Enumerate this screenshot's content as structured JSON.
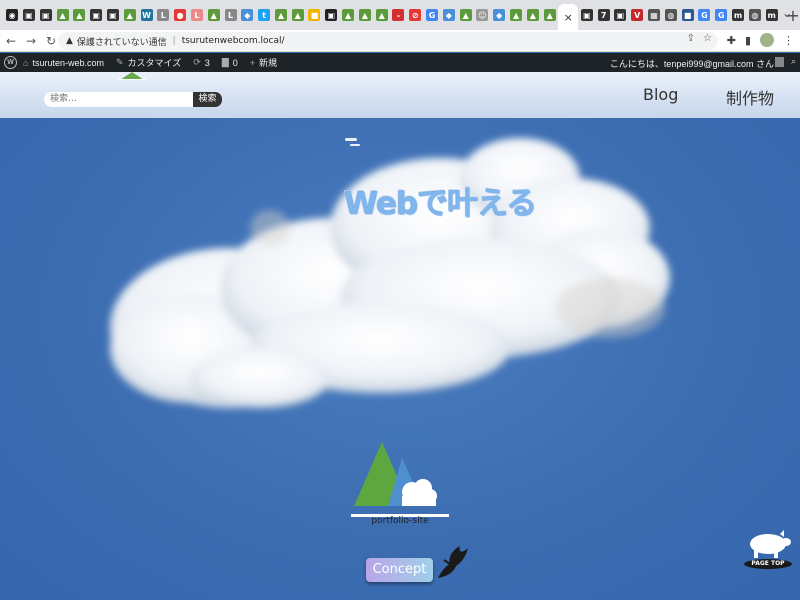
{
  "browser": {
    "tabs": [
      {
        "icon": "github-icon",
        "color": "#222",
        "glyph": "◉"
      },
      {
        "icon": "app-icon",
        "color": "#333",
        "glyph": "▣"
      },
      {
        "icon": "app-icon",
        "color": "#333",
        "glyph": "▣"
      },
      {
        "icon": "site-icon",
        "color": "#5c9b3c",
        "glyph": "▲"
      },
      {
        "icon": "site-icon",
        "color": "#5c9b3c",
        "glyph": "▲"
      },
      {
        "icon": "app-icon",
        "color": "#333",
        "glyph": "▣"
      },
      {
        "icon": "app-icon",
        "color": "#333",
        "glyph": "▣"
      },
      {
        "icon": "site-icon",
        "color": "#5c9b3c",
        "glyph": "▲"
      },
      {
        "icon": "wordpress-icon",
        "color": "#21759b",
        "glyph": "W"
      },
      {
        "icon": "life-icon",
        "color": "#888",
        "glyph": "L"
      },
      {
        "icon": "record-icon",
        "color": "#e53935",
        "glyph": "●"
      },
      {
        "icon": "life-icon",
        "color": "#e88",
        "glyph": "L"
      },
      {
        "icon": "site-icon",
        "color": "#5c9b3c",
        "glyph": "▲"
      },
      {
        "icon": "life-icon",
        "color": "#888",
        "glyph": "L"
      },
      {
        "icon": "shield-icon",
        "color": "#4a90d9",
        "glyph": "◆"
      },
      {
        "icon": "twitter-icon",
        "color": "#1da1f2",
        "glyph": "t"
      },
      {
        "icon": "site-icon",
        "color": "#5c9b3c",
        "glyph": "▲"
      },
      {
        "icon": "site-icon",
        "color": "#5c9b3c",
        "glyph": "▲"
      },
      {
        "icon": "folder-icon",
        "color": "#f4b400",
        "glyph": "■"
      },
      {
        "icon": "app-icon",
        "color": "#222",
        "glyph": "▣"
      },
      {
        "icon": "site-icon",
        "color": "#5c9b3c",
        "glyph": "▲"
      },
      {
        "icon": "site-icon",
        "color": "#5c9b3c",
        "glyph": "▲"
      },
      {
        "icon": "site-icon",
        "color": "#5c9b3c",
        "glyph": "▲"
      },
      {
        "icon": "minus-icon",
        "color": "#d32f2f",
        "glyph": "–"
      },
      {
        "icon": "blocked-icon",
        "color": "#e53935",
        "glyph": "⊘"
      },
      {
        "icon": "google-icon",
        "color": "#4285f4",
        "glyph": "G"
      },
      {
        "icon": "shield-icon",
        "color": "#4a90d9",
        "glyph": "◆"
      },
      {
        "icon": "site-icon",
        "color": "#5c9b3c",
        "glyph": "▲"
      },
      {
        "icon": "person-icon",
        "color": "#999",
        "glyph": "☺"
      },
      {
        "icon": "shield-icon",
        "color": "#4a90d9",
        "glyph": "◆"
      },
      {
        "icon": "site-icon",
        "color": "#5c9b3c",
        "glyph": "▲"
      },
      {
        "icon": "site-icon",
        "color": "#5c9b3c",
        "glyph": "▲"
      },
      {
        "icon": "site-icon",
        "color": "#5c9b3c",
        "glyph": "▲"
      }
    ],
    "active_tab_close": "×",
    "tabs_after": [
      {
        "icon": "app-icon",
        "color": "#333",
        "glyph": "▣"
      },
      {
        "icon": "number-icon",
        "color": "#333",
        "glyph": "7"
      },
      {
        "icon": "app-icon",
        "color": "#333",
        "glyph": "▣"
      },
      {
        "icon": "v-icon",
        "color": "#c62828",
        "glyph": "V"
      },
      {
        "icon": "image-icon",
        "color": "#555",
        "glyph": "▦"
      },
      {
        "icon": "globe-icon",
        "color": "#555",
        "glyph": "◍"
      },
      {
        "icon": "square-icon",
        "color": "#2b5797",
        "glyph": "■"
      },
      {
        "icon": "google-icon",
        "color": "#4285f4",
        "glyph": "G"
      },
      {
        "icon": "google-icon",
        "color": "#4285f4",
        "glyph": "G"
      },
      {
        "icon": "m-icon",
        "color": "#333",
        "glyph": "m"
      },
      {
        "icon": "globe-icon",
        "color": "#555",
        "glyph": "◍"
      },
      {
        "icon": "m-icon",
        "color": "#333",
        "glyph": "m"
      }
    ],
    "new_tab": "+",
    "address": {
      "warning": "保護されていない通信",
      "url": "tsurutenwebcom.local/"
    }
  },
  "wp_admin_bar": {
    "site_name": "tsuruten-web.com",
    "customize": "カスタマイズ",
    "updates": "3",
    "comments": "0",
    "new": "新規",
    "greeting": "こんにちは、tenpei999@gmail.com さん"
  },
  "header": {
    "search_placeholder": "検索…",
    "search_button": "検索",
    "nav": [
      "Blog",
      "制作物"
    ]
  },
  "hero": {
    "title": "Webで叶える",
    "portfolio_label": "portfolio-site",
    "concept_button": "Concept",
    "pagetop_label": "PAGE TOP"
  }
}
